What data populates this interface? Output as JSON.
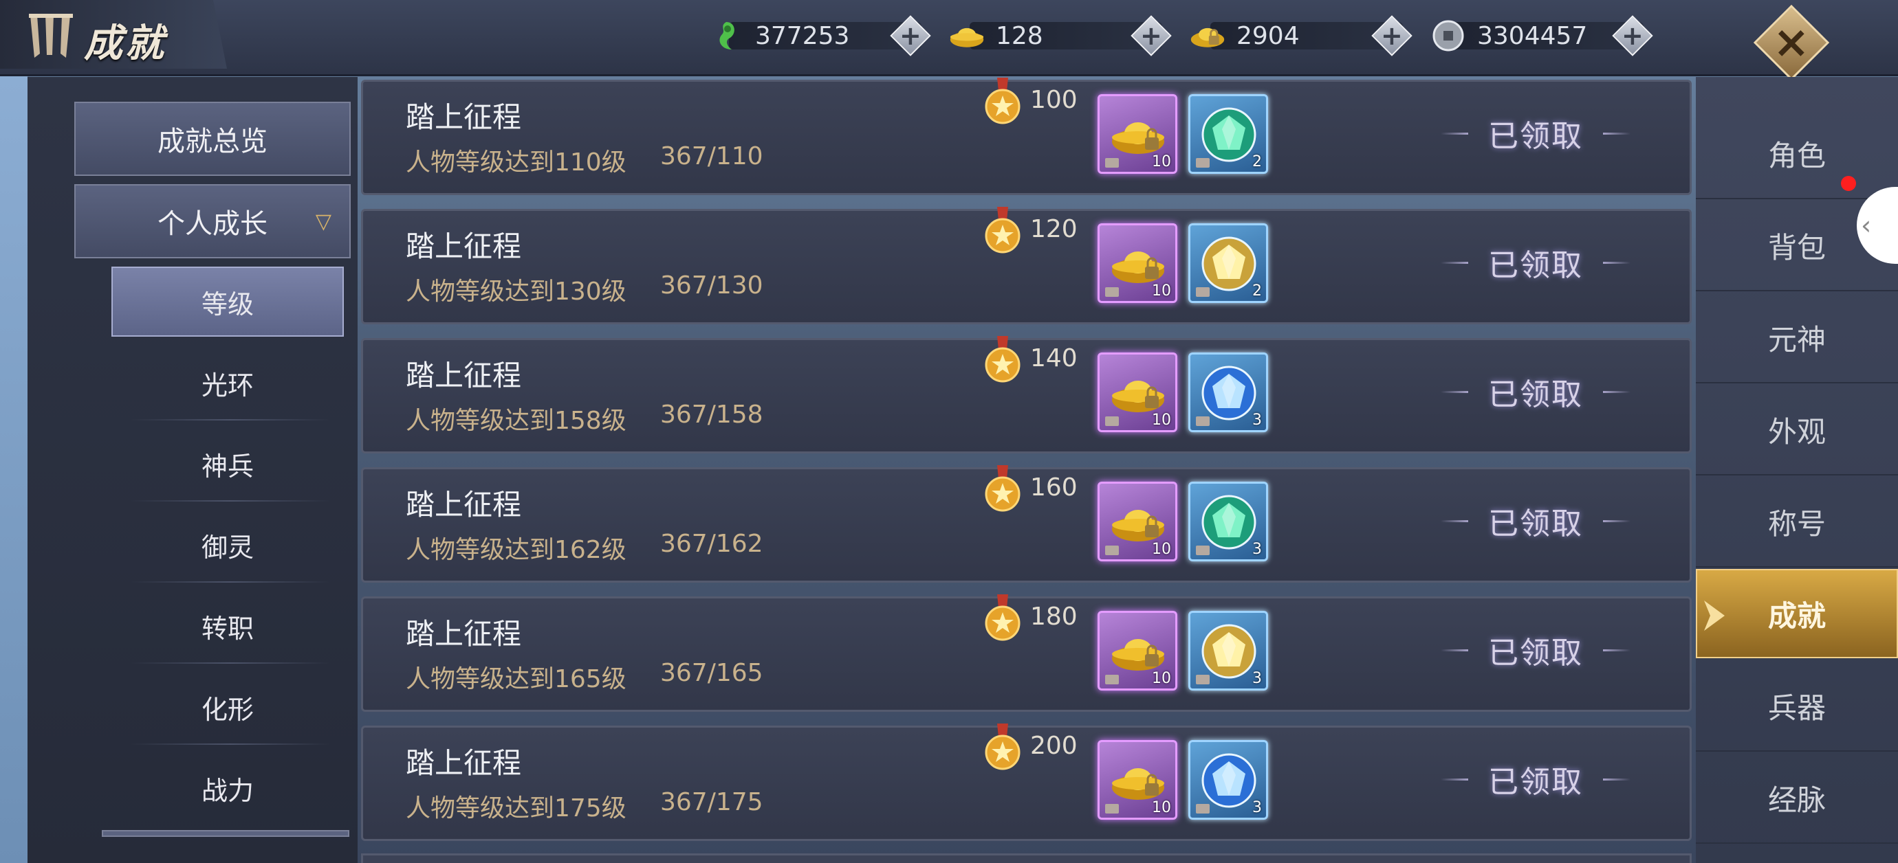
{
  "header": {
    "title": "成就",
    "currencies": [
      {
        "icon": "jade-icon",
        "value": "377253"
      },
      {
        "icon": "gold-ingot-icon",
        "value": "128"
      },
      {
        "icon": "bound-gold-ingot-icon",
        "value": "2904"
      },
      {
        "icon": "silver-coin-icon",
        "value": "3304457"
      }
    ]
  },
  "left_menu": {
    "overview": "成就总览",
    "category": "个人成长",
    "subitems": [
      "等级",
      "光环",
      "神兵",
      "御灵",
      "转职",
      "化形",
      "战力"
    ],
    "active_subitem": "等级"
  },
  "achievements": [
    {
      "title": "踏上征程",
      "desc": "人物等级达到110级",
      "progress": "367/110",
      "points": "100",
      "rewards": [
        {
          "icon": "gold-ingot-icon",
          "qty": "10"
        },
        {
          "icon": "green-gem-icon",
          "qty": "2"
        }
      ],
      "status": "已领取"
    },
    {
      "title": "踏上征程",
      "desc": "人物等级达到130级",
      "progress": "367/130",
      "points": "120",
      "rewards": [
        {
          "icon": "gold-ingot-icon",
          "qty": "10"
        },
        {
          "icon": "yellow-gem-icon",
          "qty": "2"
        }
      ],
      "status": "已领取"
    },
    {
      "title": "踏上征程",
      "desc": "人物等级达到158级",
      "progress": "367/158",
      "points": "140",
      "rewards": [
        {
          "icon": "gold-ingot-icon",
          "qty": "10"
        },
        {
          "icon": "blue-gem-icon",
          "qty": "3"
        }
      ],
      "status": "已领取"
    },
    {
      "title": "踏上征程",
      "desc": "人物等级达到162级",
      "progress": "367/162",
      "points": "160",
      "rewards": [
        {
          "icon": "gold-ingot-icon",
          "qty": "10"
        },
        {
          "icon": "green-gem-icon",
          "qty": "3"
        }
      ],
      "status": "已领取"
    },
    {
      "title": "踏上征程",
      "desc": "人物等级达到165级",
      "progress": "367/165",
      "points": "180",
      "rewards": [
        {
          "icon": "gold-ingot-icon",
          "qty": "10"
        },
        {
          "icon": "yellow-gem-icon",
          "qty": "3"
        }
      ],
      "status": "已领取"
    },
    {
      "title": "踏上征程",
      "desc": "人物等级达到175级",
      "progress": "367/175",
      "points": "200",
      "rewards": [
        {
          "icon": "gold-ingot-icon",
          "qty": "10"
        },
        {
          "icon": "blue-gem-icon",
          "qty": "3"
        }
      ],
      "status": "已领取"
    }
  ],
  "right_nav": {
    "items": [
      "角色",
      "背包",
      "元神",
      "外观",
      "称号",
      "成就",
      "兵器",
      "经脉"
    ],
    "active": "成就"
  },
  "colors": {
    "accent_gold": "#d8a945",
    "reward_purple": "#e49cff",
    "reward_blue": "#9fd4ff",
    "claimed_text": "#d8d2e8",
    "notification_red": "#ff1f1f"
  }
}
